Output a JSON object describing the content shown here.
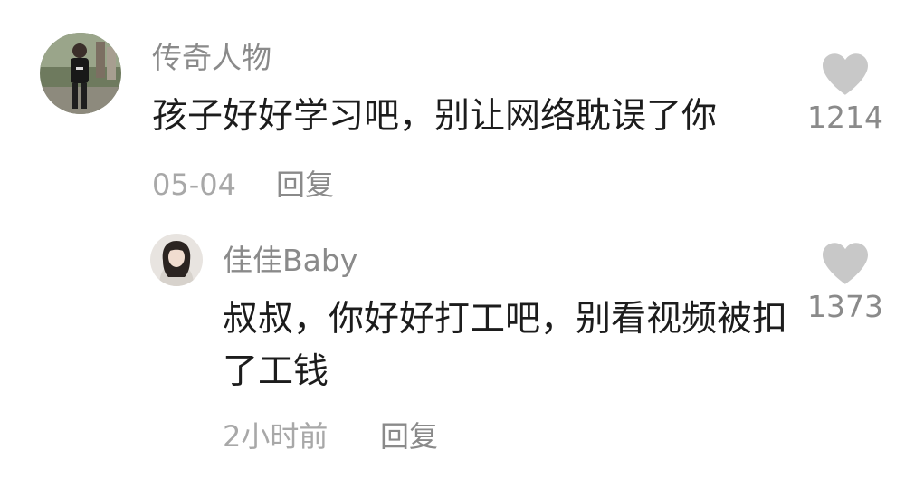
{
  "colors": {
    "text_primary": "#1c1c1c",
    "text_secondary": "#8a8a8a",
    "text_tertiary": "#a8a8a8",
    "like_icon": "#c8c8c8",
    "background": "#ffffff"
  },
  "comments": [
    {
      "username": "传奇人物",
      "avatar_icon": "user-avatar-photo",
      "text": "孩子好好学习吧，别让网络耽误了你",
      "time": "05-04",
      "reply_label": "回复",
      "like_icon": "heart-icon",
      "likes": "1214"
    },
    {
      "username": "佳佳Baby",
      "avatar_icon": "user-avatar-photo",
      "text": "叔叔，你好好打工吧，别看视频被扣了工钱",
      "time": "2小时前",
      "reply_label": "回复",
      "like_icon": "heart-icon",
      "likes": "1373"
    }
  ]
}
